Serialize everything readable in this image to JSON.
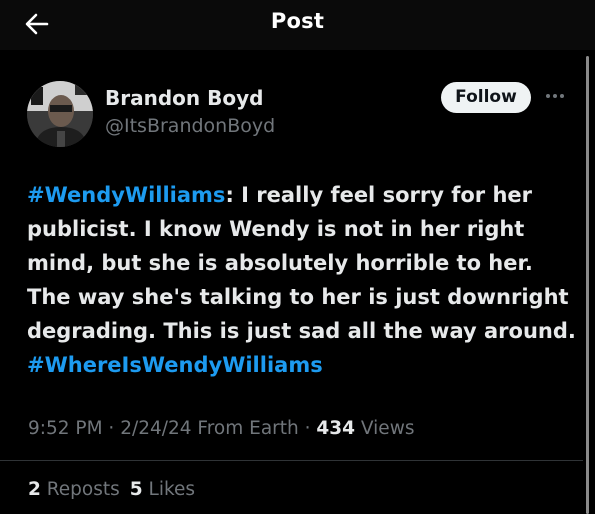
{
  "header": {
    "title": "Post",
    "back_icon": "arrow-left-icon"
  },
  "author": {
    "display_name": "Brandon Boyd",
    "handle": "@ItsBrandonBoyd",
    "avatar_icon": "user-avatar"
  },
  "actions": {
    "follow_label": "Follow",
    "more_icon": "more-horizontal-icon"
  },
  "post": {
    "hashtag_1": "#WendyWilliams",
    "text_1": ": I really feel sorry for her publicist. I know Wendy is not in her right mind, but she is absolutely horrible to her. The way she's talking to her is just downright degrading. This is just sad all the way around. ",
    "hashtag_2": "#WhereIsWendyWilliams"
  },
  "meta": {
    "time": "9:52 PM",
    "date": "2/24/24",
    "source": "From Earth",
    "separator": " · ",
    "views_count": "434",
    "views_label": "Views"
  },
  "stats": {
    "reposts_count": "2",
    "reposts_label": "Reposts",
    "likes_count": "5",
    "likes_label": "Likes"
  },
  "colors": {
    "background": "#000000",
    "text": "#e7e9ea",
    "muted": "#71767b",
    "link": "#1d9bf0",
    "follow_bg": "#eff3f4"
  }
}
